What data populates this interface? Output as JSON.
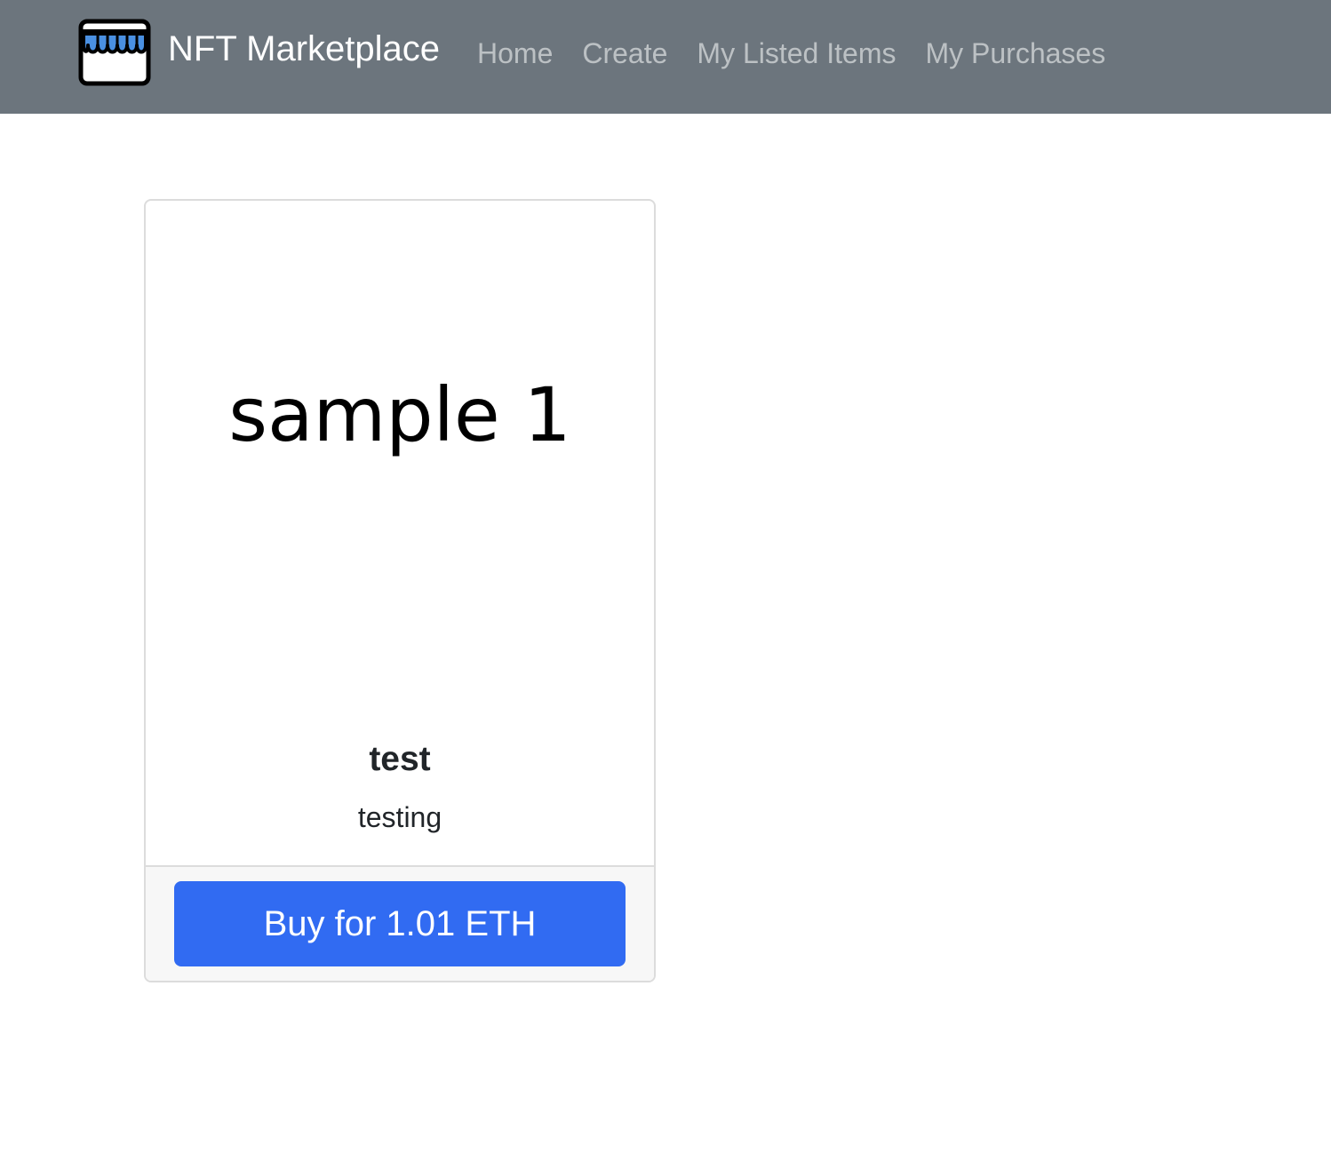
{
  "navbar": {
    "brand": {
      "name": "NFT Marketplace",
      "logo_icon": "storefront-icon"
    },
    "links": [
      {
        "label": "Home"
      },
      {
        "label": "Create"
      },
      {
        "label": "My Listed Items"
      },
      {
        "label": "My Purchases"
      }
    ]
  },
  "items": [
    {
      "image_text": "sample 1",
      "name": "test",
      "description": "testing",
      "buy_label": "Buy for 1.01 ETH"
    }
  ],
  "colors": {
    "navbar_bg": "#6c757d",
    "primary": "#316bf2",
    "awning_blue": "#4a90e2"
  }
}
